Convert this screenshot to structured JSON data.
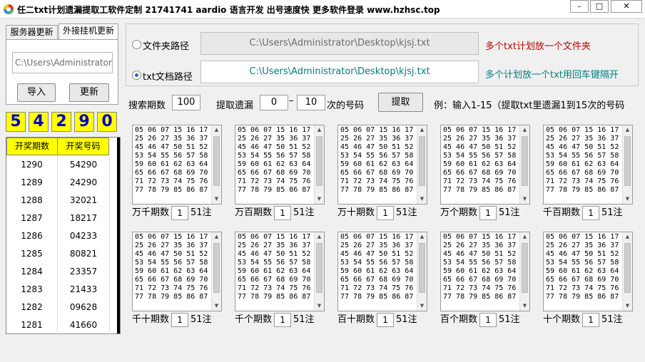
{
  "window": {
    "title": "任二txt计划遗漏提取工软件定制 21741741 aardio 语言开发 出号速度快 更多软件登录 www.hzhsc.top",
    "minimize_glyph": "–",
    "maximize_glyph": "□",
    "close_glyph": "✕"
  },
  "left_tabs": {
    "tab1": "服务器更新",
    "tab2": "外接挂机更新",
    "path_value": "C:\\Users\\Administrator\\",
    "import_label": "导入",
    "update_label": "更新"
  },
  "digits": [
    "5",
    "4",
    "2",
    "9",
    "0"
  ],
  "digit_colors": [
    "#0000cc",
    "#0000cc",
    "#0000cc",
    "#0000cc",
    "#0000cc"
  ],
  "history": {
    "col_period": "开奖期数",
    "col_number": "开奖号码",
    "rows": [
      {
        "period": "1290",
        "number": "54290"
      },
      {
        "period": "1289",
        "number": "24290"
      },
      {
        "period": "1288",
        "number": "32021"
      },
      {
        "period": "1287",
        "number": "18217"
      },
      {
        "period": "1286",
        "number": "04233"
      },
      {
        "period": "1285",
        "number": "80821"
      },
      {
        "period": "1284",
        "number": "23357"
      },
      {
        "period": "1283",
        "number": "21433"
      },
      {
        "period": "1282",
        "number": "09628"
      },
      {
        "period": "1281",
        "number": "41660"
      }
    ]
  },
  "paths": {
    "folder_label": "文件夹路径",
    "folder_value": "C:\\Users\\Administrator\\Desktop\\kjsj.txt",
    "folder_hint": "多个txt计划放一个文件夹",
    "txt_label": "txt文档路径",
    "txt_value": "C:\\Users\\Administrator\\Desktop\\kjsj.txt",
    "txt_hint": "多个计划放一个txt用回车键隔开",
    "hint_color_folder": "#c00000",
    "hint_color_txt": "#008080"
  },
  "search": {
    "count_label": "搜索期数",
    "count_value": "100",
    "omit_label": "提取遗漏",
    "from_value": "0",
    "dash": "–",
    "to_value": "10",
    "suffix": "次的号码",
    "extract_label": "提取",
    "example": "例：输入1-15（提取txt里遗漏1到15次的号码"
  },
  "box_content": "05 06 07 15 16 17\n25 26 27 35 36 37\n45 46 47 50 51 52\n53 54 55 56 57 58\n59 60 61 62 63 64\n65 66 67 68 69 70\n71 72 73 74 75 76\n77 78 79 85 86 87",
  "boxes": [
    {
      "label": "万千期数",
      "num": "1",
      "suffix": "51注"
    },
    {
      "label": "万百期数",
      "num": "1",
      "suffix": "51注"
    },
    {
      "label": "万十期数",
      "num": "1",
      "suffix": "51注"
    },
    {
      "label": "万个期数",
      "num": "1",
      "suffix": "51注"
    },
    {
      "label": "千百期数",
      "num": "1",
      "suffix": "51注"
    },
    {
      "label": "千十期数",
      "num": "1",
      "suffix": "51注"
    },
    {
      "label": "千个期数",
      "num": "1",
      "suffix": "51注"
    },
    {
      "label": "百十期数",
      "num": "1",
      "suffix": "51注"
    },
    {
      "label": "百个期数",
      "num": "1",
      "suffix": "51注"
    },
    {
      "label": "十个期数",
      "num": "1",
      "suffix": "51注"
    }
  ]
}
